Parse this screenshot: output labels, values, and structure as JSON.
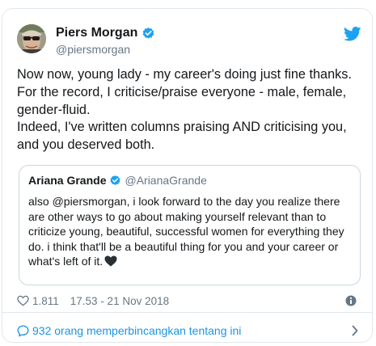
{
  "tweet": {
    "author": {
      "name": "Piers Morgan",
      "handle": "@piersmorgan",
      "verified": true
    },
    "text_lines": [
      "Now now, young lady - my career's doing just fine thanks.",
      "For the record, I criticise/praise everyone - male, female,",
      "gender-fluid.",
      "Indeed, I've written columns praising AND criticising you,",
      "and you deserved both."
    ],
    "quoted": {
      "name": "Ariana Grande",
      "handle": "@ArianaGrande",
      "verified": true,
      "text_lines": [
        "also @piersmorgan, i look forward to the day you realize there",
        "are other ways to go about making yourself relevant than to",
        "criticize young, beautiful, successful women for everything they",
        "do. i think that'll be a beautiful thing for you and your career or",
        "what's left of it."
      ],
      "emoji": "black-heart"
    },
    "likes": "1.811",
    "timestamp": "17.53 - 21 Nov 2018",
    "conversation_label": "932 orang memperbincangkan tentang ini"
  },
  "colors": {
    "twitter_blue": "#1da1f2",
    "link_blue": "#1b95e0",
    "text": "#14171a",
    "muted": "#657786",
    "border": "#e1e8ed"
  },
  "icons": [
    "avatar",
    "verified-badge-icon",
    "twitter-bird-icon",
    "heart-icon",
    "info-icon",
    "reply-bubble-icon",
    "chevron-right-icon",
    "black-heart-emoji"
  ]
}
